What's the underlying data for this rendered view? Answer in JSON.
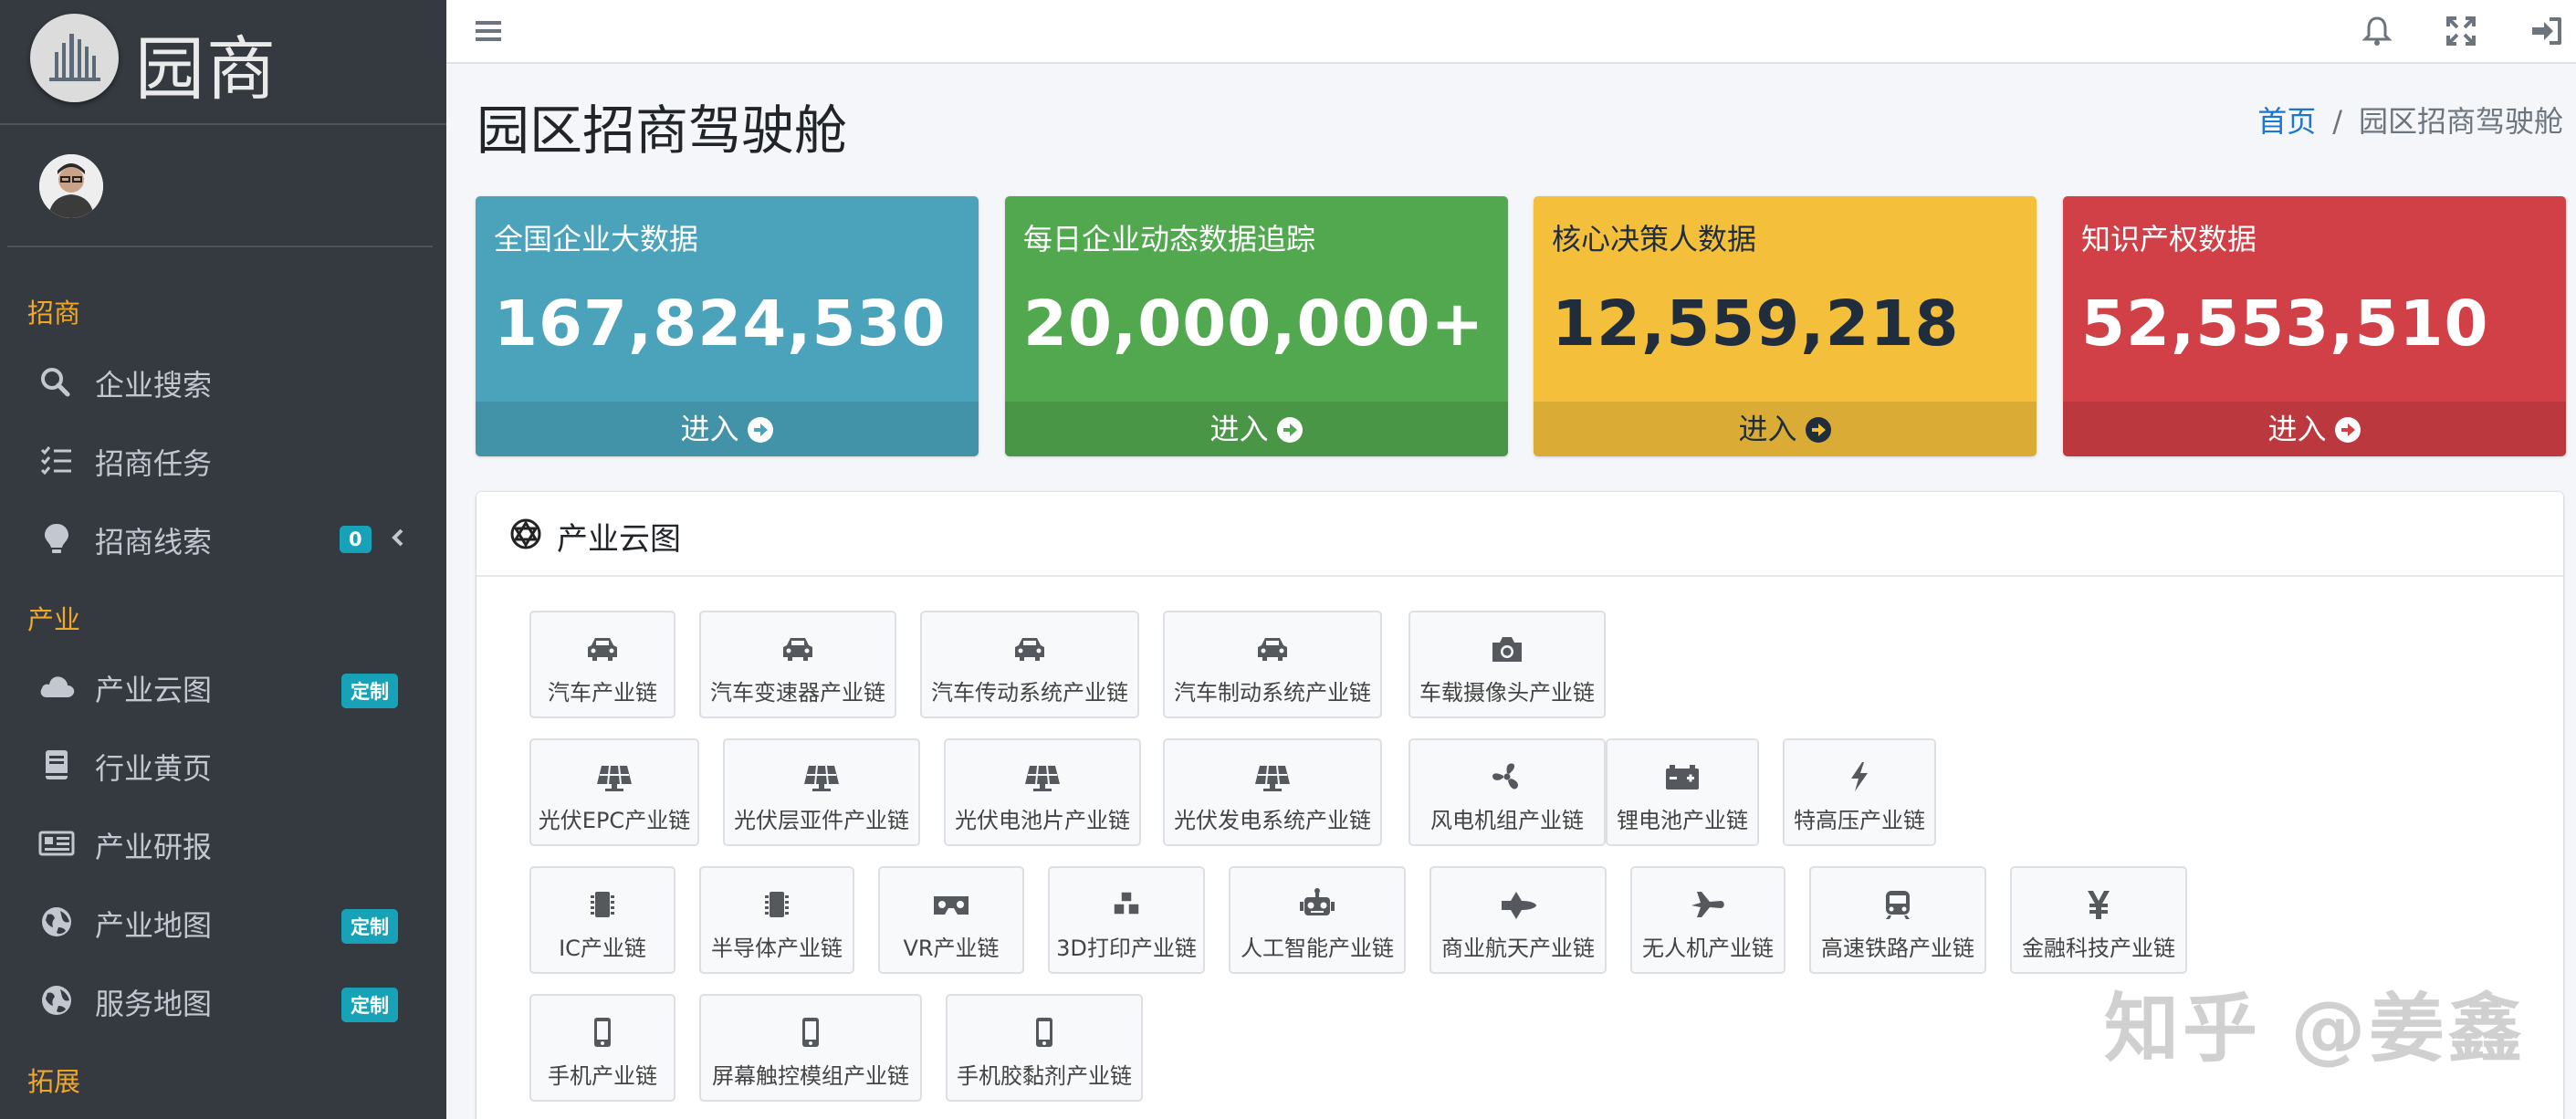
{
  "brand": {
    "name": "园商"
  },
  "sidebar": {
    "section_recruit": "招商",
    "section_industry": "产业",
    "section_expand": "拓展",
    "items": [
      {
        "label": "企业搜索",
        "icon": "search-icon"
      },
      {
        "label": "招商任务",
        "icon": "task-list-icon"
      },
      {
        "label": "招商线索",
        "icon": "lightbulb-icon",
        "badge": "0"
      },
      {
        "label": "产业云图",
        "icon": "cloud-icon",
        "badge": "定制"
      },
      {
        "label": "行业黄页",
        "icon": "book-icon"
      },
      {
        "label": "产业研报",
        "icon": "newspaper-icon"
      },
      {
        "label": "产业地图",
        "icon": "globe-icon",
        "badge": "定制"
      },
      {
        "label": "服务地图",
        "icon": "globe-icon",
        "badge": "定制"
      }
    ]
  },
  "header": {
    "title": "园区招商驾驶舱",
    "breadcrumb": {
      "home": "首页",
      "separator": "/",
      "current": "园区招商驾驶舱"
    }
  },
  "stats": [
    {
      "title": "全国企业大数据",
      "value": "167,824,530",
      "action": "进入",
      "color": "#4aa3bb"
    },
    {
      "title": "每日企业动态数据追踪",
      "value": "20,000,000+",
      "action": "进入",
      "color": "#52a84e"
    },
    {
      "title": "核心决策人数据",
      "value": "12,559,218",
      "action": "进入",
      "color": "#f4c03c"
    },
    {
      "title": "知识产权数据",
      "value": "52,553,510",
      "action": "进入",
      "color": "#d13f47"
    }
  ],
  "cloud": {
    "title": "产业云图",
    "chains": [
      {
        "label": "汽车产业链",
        "icon": "car-icon"
      },
      {
        "label": "汽车变速器产业链",
        "icon": "car-icon"
      },
      {
        "label": "汽车传动系统产业链",
        "icon": "car-icon"
      },
      {
        "label": "汽车制动系统产业链",
        "icon": "car-icon"
      },
      {
        "label": "车载摄像头产业链",
        "icon": "camera-icon"
      },
      {
        "label": "光伏EPC产业链",
        "icon": "solar-panel-icon"
      },
      {
        "label": "光伏层亚件产业链",
        "icon": "solar-panel-icon"
      },
      {
        "label": "光伏电池片产业链",
        "icon": "solar-panel-icon"
      },
      {
        "label": "光伏发电系统产业链",
        "icon": "solar-panel-icon"
      },
      {
        "label": "风电机组产业链",
        "icon": "fan-icon"
      },
      {
        "label": "锂电池产业链",
        "icon": "battery-icon"
      },
      {
        "label": "特高压产业链",
        "icon": "bolt-icon"
      },
      {
        "label": "IC产业链",
        "icon": "chip-icon"
      },
      {
        "label": "半导体产业链",
        "icon": "chip-icon"
      },
      {
        "label": "VR产业链",
        "icon": "vr-headset-icon"
      },
      {
        "label": "3D打印产业链",
        "icon": "cubes-icon"
      },
      {
        "label": "人工智能产业链",
        "icon": "robot-icon"
      },
      {
        "label": "商业航天产业链",
        "icon": "space-shuttle-icon"
      },
      {
        "label": "无人机产业链",
        "icon": "plane-icon"
      },
      {
        "label": "高速铁路产业链",
        "icon": "train-icon"
      },
      {
        "label": "金融科技产业链",
        "icon": "yen-icon"
      },
      {
        "label": "手机产业链",
        "icon": "mobile-icon"
      },
      {
        "label": "屏幕触控模组产业链",
        "icon": "mobile-icon"
      },
      {
        "label": "手机胶黏剂产业链",
        "icon": "mobile-icon"
      }
    ]
  },
  "watermark": "知乎 @姜鑫"
}
